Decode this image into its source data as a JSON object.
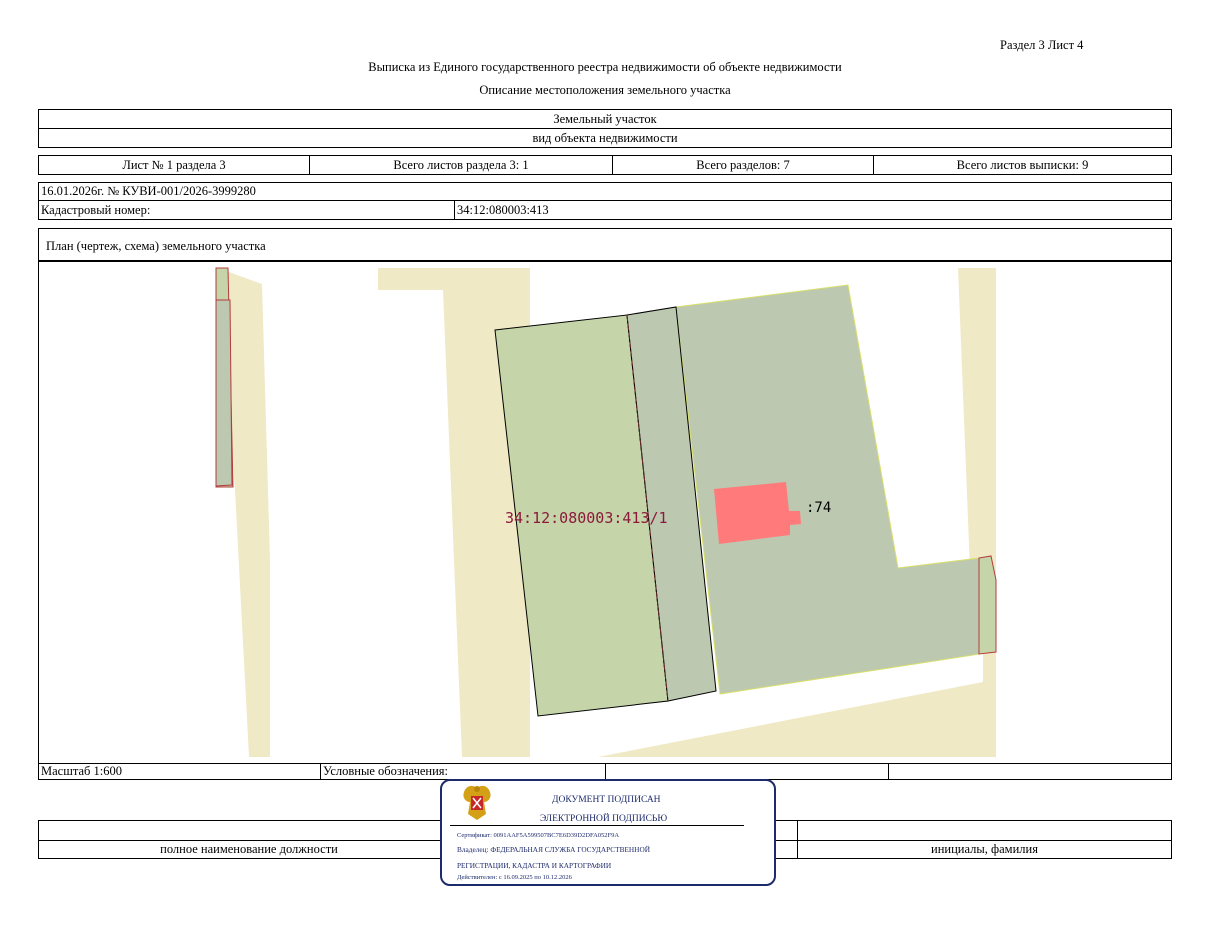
{
  "header": {
    "section_sheet": "Раздел 3    Лист 4",
    "title_line1": "Выписка из Единого государственного реестра недвижимости об объекте недвижимости",
    "title_line2": "Описание местоположения земельного участка"
  },
  "object": {
    "name": "Земельный участок",
    "kind_label": "вид объекта недвижимости"
  },
  "sheets_row": {
    "sheet_no": "Лист № 1 раздела 3",
    "total_sheets_section": "Всего листов раздела 3: 1",
    "total_sections": "Всего разделов: 7",
    "total_sheets": "Всего листов выписки: 9"
  },
  "document": {
    "date_number": "16.01.2026г. № КУВИ-001/2026-3999280",
    "cadastral_label": "Кадастровый номер:",
    "cadastral_value": "34:12:080003:413"
  },
  "plan": {
    "title": "План (чертеж, схема) земельного участка",
    "parcel_label": "34:12:080003:413/1",
    "building_label": ":74",
    "colors": {
      "road": "#f0e9c5",
      "parcel_green": "#c5d5a9",
      "parcel_gray": "#bcc8b0",
      "building": "#ff7b7b",
      "label": "#8b1a3a"
    }
  },
  "footer": {
    "scale": "Масштаб 1:600",
    "legend_label": "Условные обозначения:",
    "position_label": "полное наименование должности",
    "initials_label": "инициалы, фамилия"
  },
  "stamp": {
    "line1": "ДОКУМЕНТ ПОДПИСАН",
    "line2": "ЭЛЕКТРОННОЙ ПОДПИСЬЮ",
    "certificate": "Сертификат: 0091AAF5A599507BC7E6D39D2DFA052F9A",
    "owner_line1": "Владелец: ФЕДЕРАЛЬНАЯ СЛУЖБА ГОСУДАРСТВЕННОЙ",
    "owner_line2": "РЕГИСТРАЦИИ, КАДАСТРА И КАРТОГРАФИИ",
    "valid": "Действителен: с 16.09.2025 по 10.12.2026",
    "emblem_icon": "coat-of-arms-icon",
    "color": "#1d2a6b"
  }
}
